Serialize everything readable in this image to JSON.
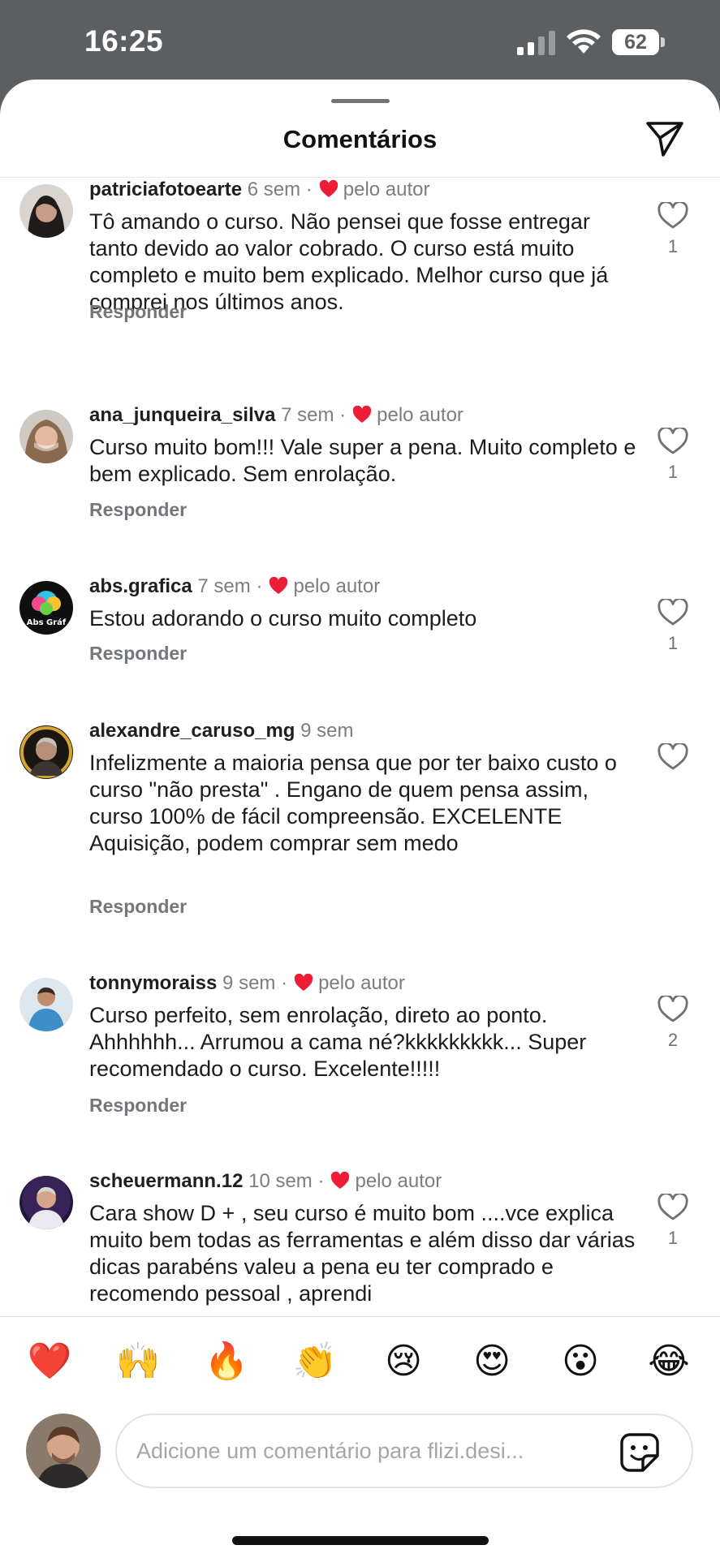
{
  "status_bar": {
    "time": "16:25",
    "battery": "62"
  },
  "sheet": {
    "title": "Comentários"
  },
  "comments": [
    {
      "username": "patriciafotoearte",
      "time": "6 sem",
      "sep": "·",
      "liked_by_author": "pelo autor",
      "text": "Tô amando o curso. Não pensei que fosse entregar tanto devido ao valor cobrado.  O curso está muito completo e muito bem explicado. Melhor curso que já comprei nos últimos anos.",
      "reply": "Responder",
      "likes": "1"
    },
    {
      "username": "ana_junqueira_silva",
      "time": "7 sem",
      "sep": "·",
      "liked_by_author": "pelo autor",
      "text": "Curso muito bom!!! Vale super a pena. Muito completo e bem explicado. Sem enrolação.",
      "reply": "Responder",
      "likes": "1"
    },
    {
      "username": "abs.grafica",
      "time": "7 sem",
      "sep": "·",
      "liked_by_author": "pelo autor",
      "text": "Estou adorando o curso muito completo",
      "reply": "Responder",
      "likes": "1"
    },
    {
      "username": "alexandre_caruso_mg",
      "time": "9 sem",
      "sep": "",
      "liked_by_author": "",
      "text": "Infelizmente a maioria pensa que por ter baixo custo o curso \"não presta\" . Engano de quem pensa assim, curso 100% de fácil compreensão. EXCELENTE Aquisição, podem comprar sem medo",
      "reply": "Responder",
      "likes": ""
    },
    {
      "username": "tonnymoraiss",
      "time": "9 sem",
      "sep": "·",
      "liked_by_author": "pelo autor",
      "text": "Curso perfeito, sem enrolação, direto ao ponto. Ahhhhhh... Arrumou a cama né?kkkkkkkkk... Super recomendado o curso. Excelente!!!!!",
      "reply": "Responder",
      "likes": "2"
    },
    {
      "username": "scheuermann.12",
      "time": "10 sem",
      "sep": "·",
      "liked_by_author": "pelo autor",
      "text": "Cara show D + ,  seu curso é muito bom ....vce explica muito bem todas as ferramentas e além disso dar várias dicas parabéns  valeu a pena  eu ter comprado e recomendo pessoal , aprendi",
      "reply": "",
      "likes": "1"
    }
  ],
  "quick_reactions": [
    "❤️",
    "🙌",
    "🔥",
    "👏",
    "😢",
    "😍",
    "😮",
    "😂"
  ],
  "composer": {
    "placeholder": "Adicione um comentário para flizi.desi..."
  },
  "colors": {
    "heart_red": "#ee1d36",
    "meta_gray": "#7a7d82",
    "status_bg": "#5c5f62"
  }
}
